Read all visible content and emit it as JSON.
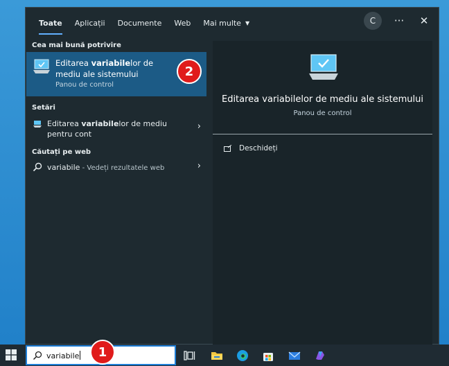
{
  "search_panel": {
    "tabs": [
      {
        "label": "Toate",
        "active": true
      },
      {
        "label": "Aplicații",
        "active": false
      },
      {
        "label": "Documente",
        "active": false
      },
      {
        "label": "Web",
        "active": false
      },
      {
        "label": "Mai multe",
        "active": false
      }
    ],
    "account_initial": "C",
    "more_icon": "ellipsis-icon",
    "close_icon": "close-icon",
    "best_match": {
      "section_title": "Cea mai bună potrivire",
      "title_pre": "Editarea ",
      "title_bold": "variabile",
      "title_post": "lor de mediu ale sistemului",
      "subtitle": "Panou de control"
    },
    "settings": {
      "section_title": "Setări",
      "item_pre": "Editarea ",
      "item_bold": "variabile",
      "item_post": "lor de mediu pentru cont"
    },
    "web": {
      "section_title": "Căutați pe web",
      "query": "variabile",
      "suffix": " - Vedeți rezultatele web"
    },
    "detail": {
      "title": "Editarea variabilelor de mediu ale sistemului",
      "subtitle": "Panou de control",
      "action_open": "Deschideți"
    }
  },
  "taskbar": {
    "search_value": "variabile",
    "icons": [
      "windows-start-icon",
      "search-icon",
      "task-view-icon",
      "file-explorer-icon",
      "edge-icon",
      "store-icon",
      "mail-icon",
      "copilot-icon"
    ]
  },
  "badges": {
    "first": "1",
    "second": "2"
  },
  "colors": {
    "accent": "#62b0ff",
    "selected": "#1c5b86",
    "badge": "#e01b1b",
    "panel": "#1e2a30"
  }
}
